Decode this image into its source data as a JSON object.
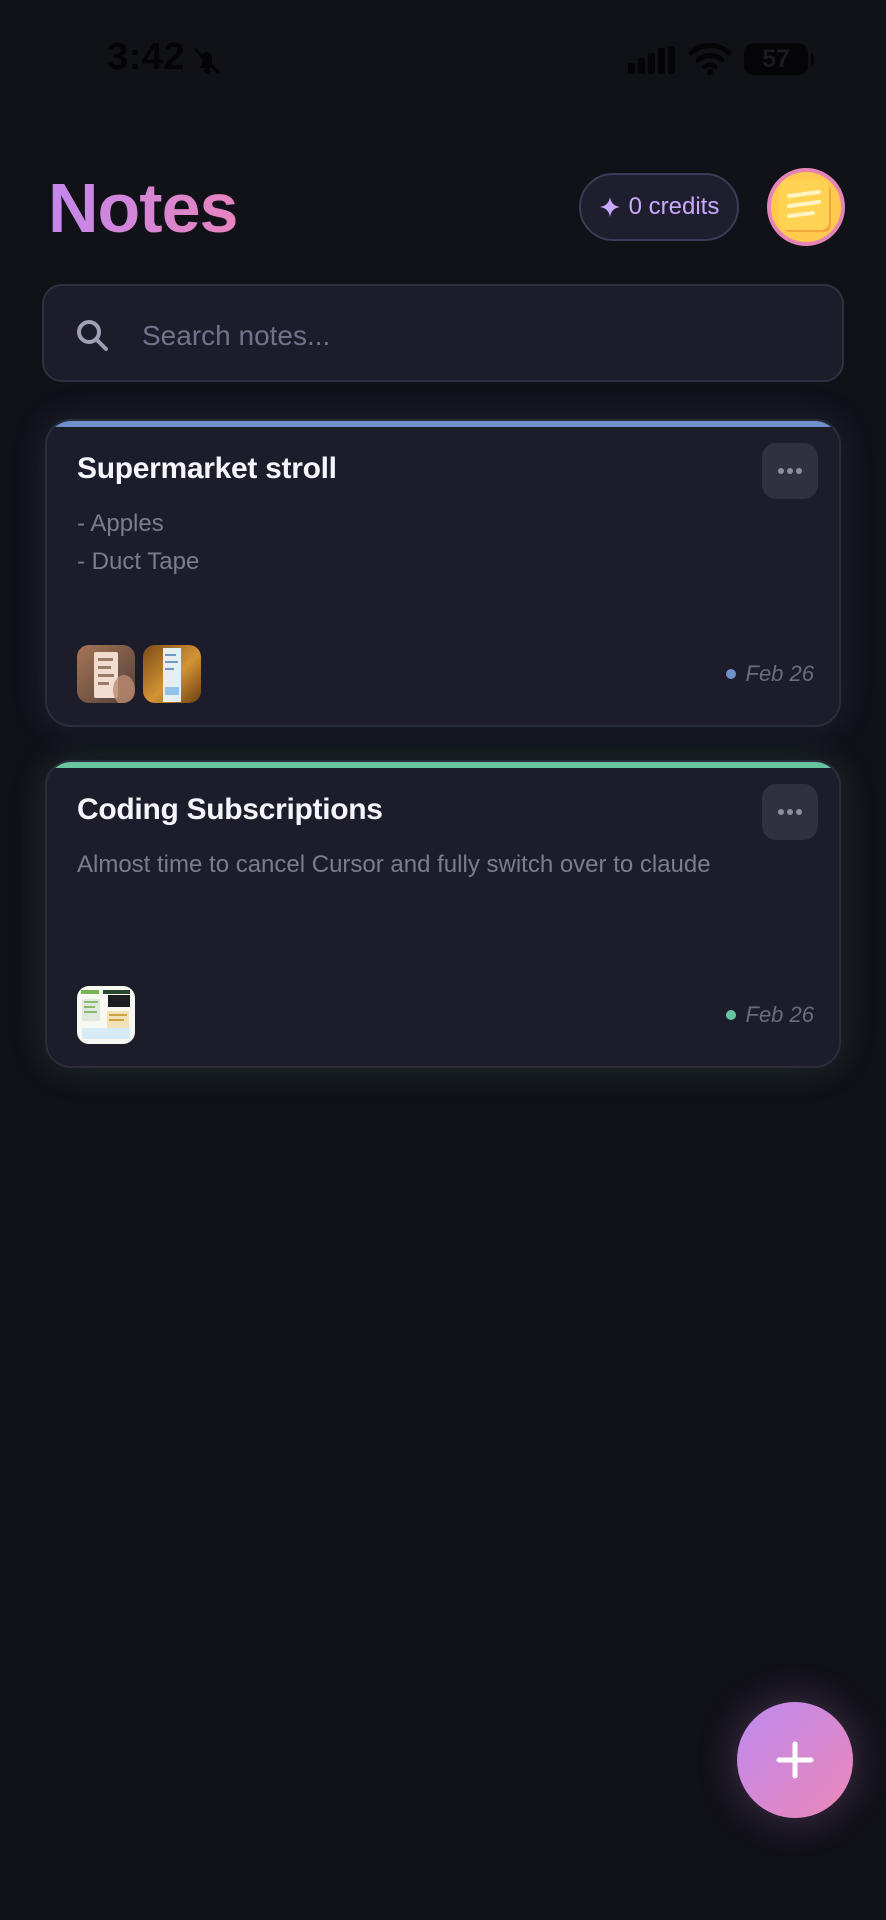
{
  "status_bar": {
    "time": "3:42",
    "battery": "57"
  },
  "header": {
    "title": "Notes",
    "credits_label": "0 credits"
  },
  "search": {
    "placeholder": "Search notes..."
  },
  "notes": [
    {
      "title": "Supermarket stroll",
      "body_lines": [
        "- Apples",
        "- Duct Tape"
      ],
      "date": "Feb 26",
      "accent_color": "#6f91c9"
    },
    {
      "title": "Coding Subscriptions",
      "body_lines": [
        "Almost time to cancel Cursor and fully switch over to claude"
      ],
      "date": "Feb 26",
      "accent_color": "#67c59f"
    }
  ],
  "icons": {
    "search": "search-icon",
    "more": "more-horizontal-icon",
    "add": "plus-icon",
    "credits": "sparkle-icon",
    "avatar": "sticky-note-icon"
  },
  "colors": {
    "background": "#111118",
    "card": "#1c1c2b",
    "title_gradient_start": "#c287ec",
    "title_gradient_end": "#e884bf"
  }
}
